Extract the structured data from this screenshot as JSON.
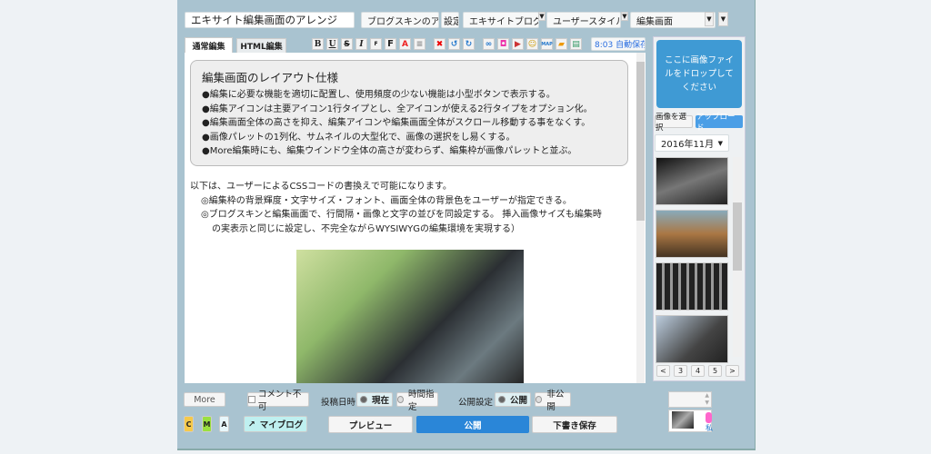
{
  "header": {
    "title": "エキサイト編集画面のアレンジ",
    "skin_select": "ブログスキンのア",
    "settings_button": "設定",
    "blog_select": "エキサイトブログ",
    "style_select": "ユーザースタイル:",
    "mode_select": "編集画面"
  },
  "tabs": [
    {
      "label": "通常編集"
    },
    {
      "label": "HTML編集"
    }
  ],
  "toolbar": {
    "bold": "B",
    "underline": "U",
    "strike": "S",
    "italic": "I",
    "small": "F",
    "large": "F",
    "color": "A",
    "autosave": "8:03 自動保存"
  },
  "content": {
    "spec_title": "編集画面のレイアウト仕様",
    "spec_items": [
      "●編集に必要な機能を適切に配置し、使用頻度の少ない機能は小型ボタンで表示する。",
      "●編集アイコンは主要アイコン1行タイプとし、全アイコンが使える2行タイプをオプション化。",
      "●編集画面全体の高さを抑え、編集アイコンや編集画面全体がスクロール移動する事をなくす。",
      "●画像パレットの1列化、サムネイルの大型化で、画像の選択をし易くする。",
      "●More編集時にも、編集ウインドウ全体の高さが変わらず、編集枠が画像パレットと並ぶ。"
    ],
    "intro": "以下は、ユーザーによるCSSコードの書換えで可能になります。",
    "points": [
      "◎編集枠の背景輝度・文字サイズ・フォント、画面全体の背景色をユーザーが指定できる。",
      "◎ブログスキンと編集画面で、行間隔・画像と文字の並びを同設定する。 挿入画像サイズも編集時",
      "の実表示と同じに設定し、不完全ながらWYSIWYGの編集環境を実現する）"
    ]
  },
  "sidebar": {
    "drop_text": "ここに画像ファイルをドロップしてください",
    "select_button": "画像を選択",
    "upload_button": "アップロード",
    "month": "2016年11月",
    "pages": [
      "<",
      "3",
      "4",
      "5",
      ">"
    ]
  },
  "footer": {
    "more": "More",
    "no_comment": "コメント不可",
    "post_time_label": "投稿日時",
    "now": "現在",
    "time_specify": "時間指定",
    "publish_label": "公開設定",
    "public": "公開",
    "private": "非公開",
    "c": "C",
    "m": "M",
    "a": "A",
    "my_blog": "マイブログ",
    "preview": "プレビュー",
    "publish": "公開",
    "draft": "下書き保存",
    "emoji_hint": "私"
  }
}
